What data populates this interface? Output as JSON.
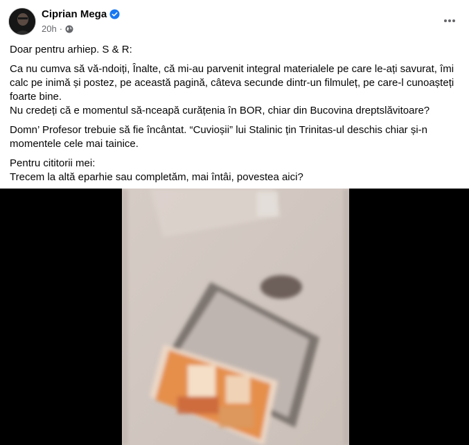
{
  "post": {
    "author": "Ciprian Mega",
    "time": "20h",
    "visibility_icon": "globe-icon",
    "verified_icon": "verified-badge-icon",
    "more_icon": "more-options-icon",
    "paragraphs": [
      [
        "Doar pentru arhiep. S & R:"
      ],
      [
        "Ca nu cumva să vă-ndoiți, Înalte, că mi-au parvenit integral materialele pe care le-ați savurat, îmi calc pe inimă și postez, pe această pagină, câteva secunde dintr-un filmuleț, pe care-l cunoașteți foarte bine.",
        "Nu credeți că e momentul să-nceapă curățenia în BOR, chiar din Bucovina dreptslăvitoare?"
      ],
      [
        "Domn’ Profesor trebuie să fie încântat. “Cuvioșii” lui Stalinic țin Trinitas-ul deschis chiar și-n momentele cele mai tainice."
      ],
      [
        "Pentru cititorii mei:",
        "Trecem la altă eparhie sau completăm, mai întâi, povestea aici?"
      ]
    ]
  },
  "colors": {
    "verified": "#1877f2",
    "meta_text": "#65676b",
    "media_bg": "#000000"
  }
}
